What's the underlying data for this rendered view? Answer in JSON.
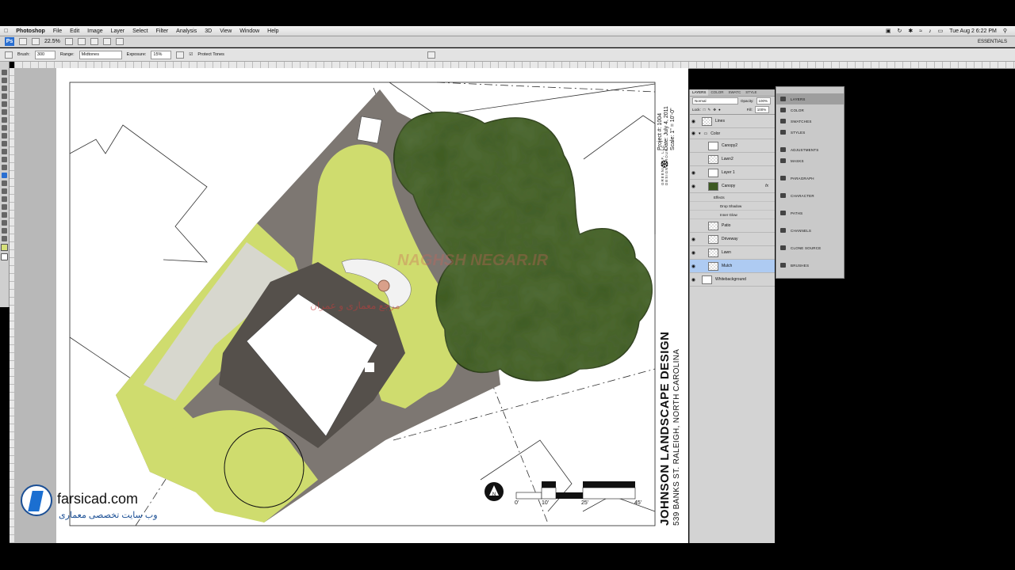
{
  "menubar": {
    "app": "Photoshop",
    "items": [
      "File",
      "Edit",
      "Image",
      "Layer",
      "Select",
      "Filter",
      "Analysis",
      "3D",
      "View",
      "Window",
      "Help"
    ],
    "clock": "Tue Aug 2  6:22 PM"
  },
  "appbar": {
    "logo": "Ps",
    "zoom": "22.5%",
    "workspace": "ESSENTIALS"
  },
  "options": {
    "brush_label": "Brush:",
    "brush_size": "300",
    "range_label": "Range:",
    "range_value": "Midtones",
    "exposure_label": "Exposure:",
    "exposure_value": "15%",
    "protect_tones": "Protect Tones"
  },
  "layers_panel": {
    "tabs": [
      "LAYERS",
      "COLOR",
      "SWATC",
      "STYLE"
    ],
    "blend_mode": "Normal",
    "opacity_label": "Opacity:",
    "opacity_value": "100%",
    "lock_label": "Lock:",
    "fill_label": "Fill:",
    "fill_value": "100%",
    "layers": [
      {
        "name": "Lines",
        "visible": true,
        "selected": false
      },
      {
        "name": "Color",
        "visible": true,
        "selected": false,
        "group": true
      },
      {
        "name": "Canopy2",
        "visible": false,
        "selected": false
      },
      {
        "name": "Lawn2",
        "visible": false,
        "selected": false
      },
      {
        "name": "Layer 1",
        "visible": true,
        "selected": false
      },
      {
        "name": "Canopy",
        "visible": true,
        "selected": false,
        "fx": "fx"
      },
      {
        "name": "Patio",
        "visible": false,
        "selected": false
      },
      {
        "name": "Driveway",
        "visible": true,
        "selected": false
      },
      {
        "name": "Lawn",
        "visible": true,
        "selected": false
      },
      {
        "name": "Mulch",
        "visible": true,
        "selected": true
      },
      {
        "name": "Whitebackground",
        "visible": true,
        "selected": false
      }
    ],
    "effects_label": "Effects",
    "effects": [
      "Drop Shadow",
      "Inner Glow"
    ]
  },
  "dock": {
    "items": [
      "LAYERS",
      "COLOR",
      "SWATCHES",
      "STYLES",
      "ADJUSTMENTS",
      "MASKS",
      "PARAGRAPH",
      "CHARACTER",
      "PATHS",
      "CHANNELS",
      "CLONE SOURCE",
      "BRUSHES"
    ]
  },
  "titleblock": {
    "project": "Project #: 1004",
    "date": "Date: July 4, 2011",
    "scale": "Scale: 1\" = 10'-0\"",
    "firm1": "GREENLEAF, LLC",
    "firm2": "DESIGN GROUP",
    "title": "JOHNSON LANDSCAPE DESIGN",
    "address": "539 BANKS ST.  RALEIGH, NORTH CAROLINA"
  },
  "scalebar": {
    "ticks": [
      "0'",
      "10'",
      "25'",
      "45'"
    ]
  },
  "watermark": {
    "site": "farsicad.com",
    "tagline": "وب سایت تخصصی معماری",
    "center_title": "NAGHSH NEGAR.IR",
    "center_sub": "مرجع معماری و عمران"
  },
  "colors": {
    "lawn": "#cfdc6e",
    "mulch": "#7d7772",
    "canopy": "#3d5a22",
    "selection": "#aecbf2"
  }
}
